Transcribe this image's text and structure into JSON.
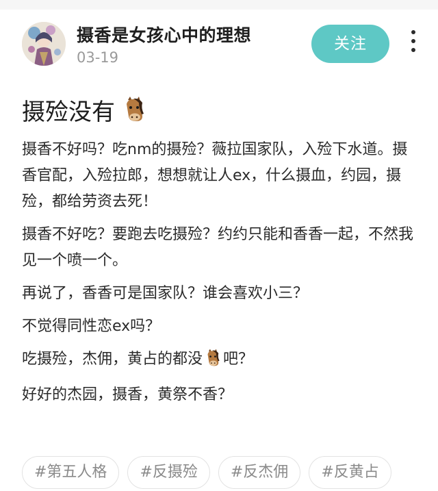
{
  "header": {
    "author_name": "摄香是女孩心中的理想",
    "date": "03-19",
    "follow_label": "关注"
  },
  "post": {
    "title": "摄殓没有",
    "paragraphs": [
      [
        "摄香不好吗？吃nm的摄殓？薇拉国家队，入殓下水道。摄香官配，入殓拉郎，想想就让人ex，什么摄血，约园，摄殓，都给劳资去死！"
      ],
      [
        "摄香不好吃？要跑去吃摄殓？约约只能和香香一起，不然我见一个喷一个。"
      ],
      [
        "再说了，香香可是国家队？谁会喜欢小三？"
      ],
      [
        "不觉得同性恋ex吗？"
      ],
      [
        "吃摄殓，杰佣，黄占的都没",
        "吧？"
      ],
      [
        "好好的杰园，摄香，黄祭不香？"
      ]
    ]
  },
  "tags": [
    "#第五人格",
    "#反摄殓",
    "#反杰佣",
    "#反黄占"
  ],
  "colors": {
    "accent": "#5ec8c5",
    "muted_text": "#9a9a9a"
  },
  "icons": {
    "title_emoji": "horse-face-icon",
    "inline_emoji": "horse-face-icon",
    "menu": "more-vertical-icon"
  }
}
